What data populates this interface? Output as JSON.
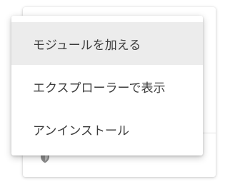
{
  "menu": {
    "items": [
      {
        "label": "モジュールを加える",
        "highlighted": true
      },
      {
        "label": "エクスプローラーで表示",
        "highlighted": false
      },
      {
        "label": "アンインストール",
        "highlighted": false
      }
    ]
  },
  "background_card": {
    "icon": "shield-icon"
  },
  "colors": {
    "highlight_bg": "#ececec",
    "menu_text": "#3c3c3c",
    "icon": "#8a8a8a"
  }
}
